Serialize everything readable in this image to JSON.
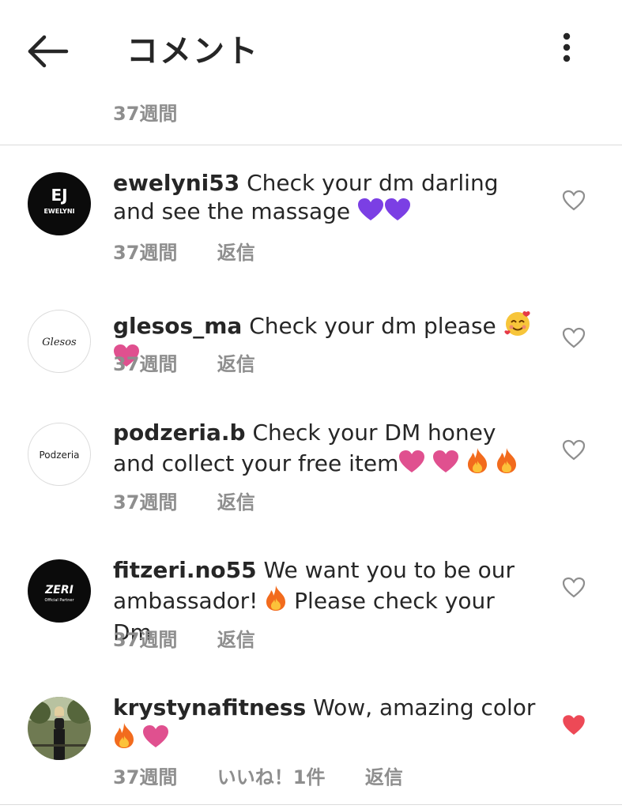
{
  "header": {
    "title": "コメント"
  },
  "top_time": "37週間",
  "comments": [
    {
      "username": "ewelyni53",
      "text": "Check your dm darling and see the massage",
      "emoji": [
        "purple-heart",
        "purple-heart"
      ],
      "time": "37週間",
      "reply": "返信",
      "liked": false,
      "avatar_text": "EWELYNI",
      "avatar_mark": "EJ"
    },
    {
      "username": "glesos_ma",
      "text": "Check your dm please",
      "emoji": [
        "smiling-face-with-hearts",
        "pink-heart"
      ],
      "time": "37週間",
      "reply": "返信",
      "liked": false,
      "avatar_text": "Glesos"
    },
    {
      "username": "podzeria.b",
      "text": "Check your DM honey and collect your free item",
      "emoji": [
        "pink-heart",
        "pink-heart",
        "fire",
        "fire"
      ],
      "time": "37週間",
      "reply": "返信",
      "liked": false,
      "avatar_text": "Podzeria"
    },
    {
      "username": "fitzeri.no55",
      "text_before": "We want you to be our ambassador!",
      "text_after": "Please check your Dm",
      "emoji": [
        "fire"
      ],
      "time": "37週間",
      "reply": "返信",
      "liked": false,
      "avatar_text": "ZERI",
      "avatar_subtext": "Official Partner"
    },
    {
      "username": "krystynafitness",
      "text": "Wow, amazing color",
      "emoji": [
        "fire",
        "pink-heart"
      ],
      "time": "37週間",
      "likes": "いいね！1件",
      "reply": "返信",
      "liked": true
    }
  ],
  "colors": {
    "text": "#262626",
    "muted": "#8e8e8e",
    "like_red": "#ed4956",
    "purple": "#7b3fe4",
    "pink": "#e0508f",
    "divider": "#dbdbdb"
  }
}
